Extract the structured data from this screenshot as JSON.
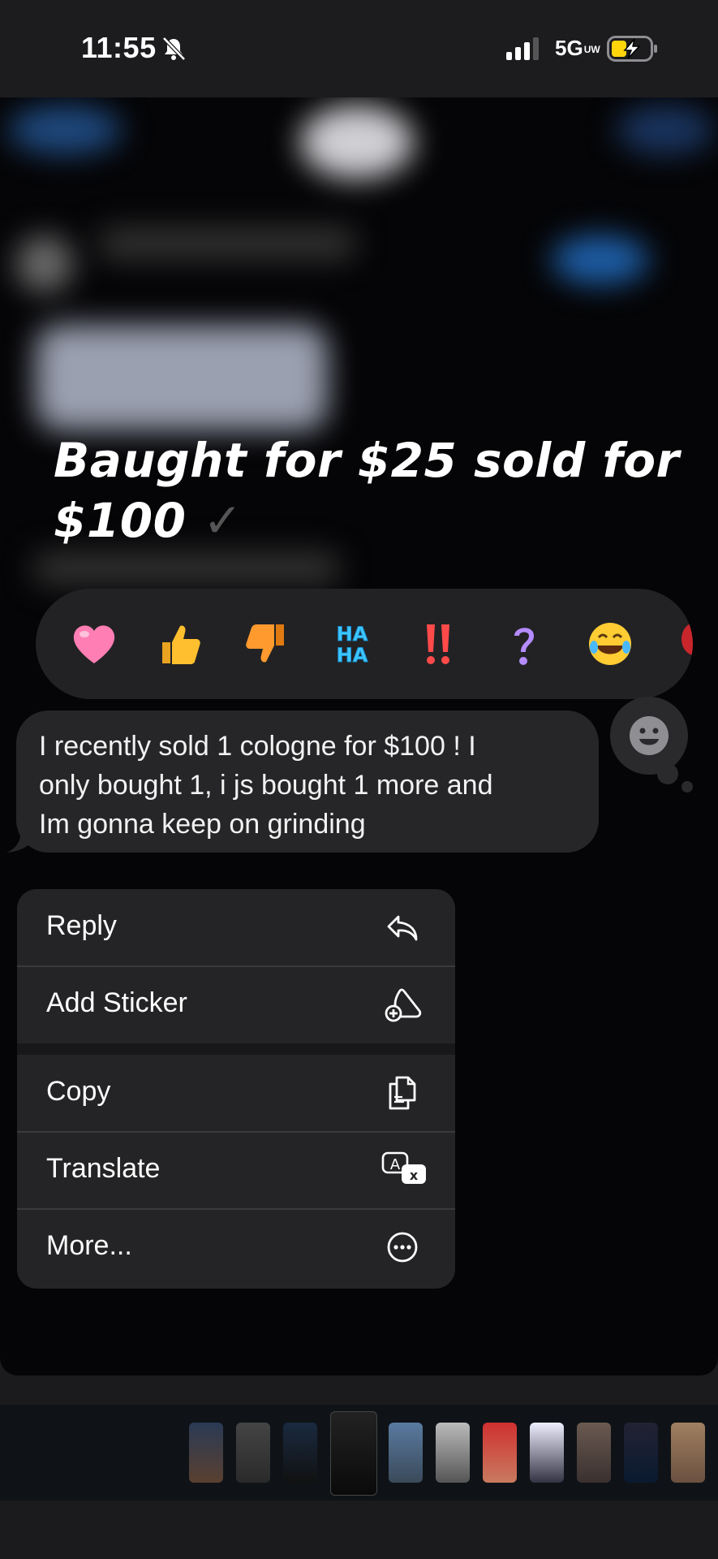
{
  "status_bar": {
    "time": "11:55",
    "network": "5G",
    "network_sub": "UW",
    "icons": [
      "bell-slash-icon",
      "cellular-signal-icon",
      "battery-charging-icon"
    ]
  },
  "post": {
    "caption_line1": "Baught for $25 sold for",
    "caption_line2": "$100",
    "caption_mark": "✓"
  },
  "tapback": {
    "reactions": [
      "heart",
      "thumbs-up",
      "thumbs-down",
      "haha",
      "exclamation",
      "question",
      "laughing-face",
      "balloon"
    ],
    "haha_text": "HA"
  },
  "message": {
    "line1": "I recently sold 1 cologne for $100 ! I",
    "line2": "only bought 1, i js bought 1 more and",
    "line3": "Im gonna keep on grinding"
  },
  "menu": {
    "items": [
      {
        "label": "Reply",
        "icon": "reply-arrow-icon"
      },
      {
        "label": "Add Sticker",
        "icon": "add-sticker-icon"
      },
      {
        "label": "Copy",
        "icon": "copy-icon"
      },
      {
        "label": "Translate",
        "icon": "translate-icon"
      },
      {
        "label": "More...",
        "icon": "more-ellipsis-icon"
      }
    ]
  },
  "thumbnails": {
    "count": 12,
    "active_index": 3
  },
  "colors": {
    "background": "#050507",
    "menu_bg": "#242426",
    "bubble_bg": "#262628",
    "battery_accent": "#ffd60a"
  }
}
